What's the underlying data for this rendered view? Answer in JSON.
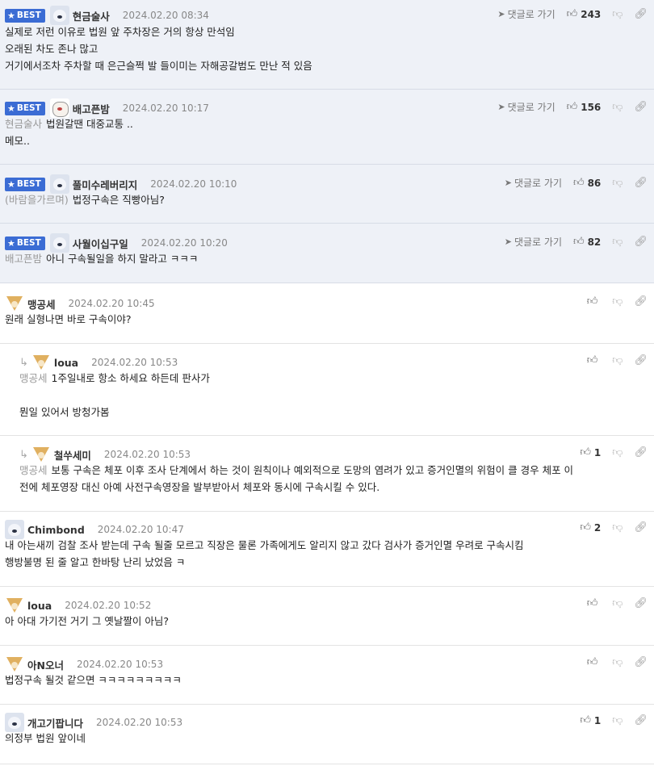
{
  "labels": {
    "best": "BEST",
    "goto": "댓글로 가기"
  },
  "comments": [
    {
      "best": true,
      "avatar": "bear",
      "nick": "현금술사",
      "date": "2024.02.20 08:34",
      "votes": "243",
      "mention": "",
      "lines": [
        "실제로 저런 이유로 법원 앞 주차장은 거의 항상 만석임",
        "오래된 차도 존나 많고",
        "거기에서조차 주차할 때 은근슬쩍 발 들이미는 자해공갈범도 만난 적 있음"
      ]
    },
    {
      "best": true,
      "avatar": "dog",
      "nick": "배고픈밤",
      "date": "2024.02.20 10:17",
      "votes": "156",
      "mention": "현금술사",
      "lines": [
        "법원갈땐 대중교통 ..",
        "메모.."
      ]
    },
    {
      "best": true,
      "avatar": "bear",
      "nick": "풀미수레버리지",
      "date": "2024.02.20 10:10",
      "votes": "86",
      "mention": "(바람을가르며)",
      "lines": [
        "법정구속은 직빵아님?"
      ]
    },
    {
      "best": true,
      "avatar": "bear",
      "nick": "사월이십구일",
      "date": "2024.02.20 10:20",
      "votes": "82",
      "mention": "배고픈밤",
      "lines": [
        "아니 구속될일을 하지 말라고 ㅋㅋㅋ"
      ]
    },
    {
      "best": false,
      "avatar": "fox",
      "nick": "맹공세",
      "date": "2024.02.20 10:45",
      "votes": "",
      "mention": "",
      "lines": [
        "원래 실형나면 바로 구속이야?"
      ]
    },
    {
      "best": false,
      "reply": true,
      "avatar": "fox",
      "nick": "loua",
      "date": "2024.02.20 10:53",
      "votes": "",
      "mention": "맹공세",
      "lines": [
        "1주일내로 항소 하세요 하든데 판사가",
        "",
        "뭔일 있어서 방청가봄"
      ]
    },
    {
      "best": false,
      "reply": true,
      "avatar": "fox",
      "nick": "철쑤세미",
      "date": "2024.02.20 10:53",
      "votes": "1",
      "mention": "맹공세",
      "lines": [
        "보통 구속은 체포 이후 조사 단계에서 하는 것이 원칙이나 예외적으로 도망의 염려가 있고 증거인멸의 위험이 클 경우 체포 이",
        "전에 체포영장 대신 아예 사전구속영장을 발부받아서 체포와 동시에 구속시킬 수 있다."
      ]
    },
    {
      "best": false,
      "avatar": "bear",
      "nick": "Chimbond",
      "date": "2024.02.20 10:47",
      "votes": "2",
      "mention": "",
      "lines": [
        "내 아는새끼 검찰 조사 받는데 구속 될줄 모르고 직장은 물론 가족에게도 알리지 않고 갔다 검사가 증거인멸 우려로 구속시킴",
        "행방불명 된 줄 알고 한바탕 난리 났었음 ㅋ"
      ]
    },
    {
      "best": false,
      "avatar": "fox",
      "nick": "loua",
      "date": "2024.02.20 10:52",
      "votes": "",
      "mention": "",
      "lines": [
        "아 아대 가기전 거기 그 옛날짤이 아님?"
      ]
    },
    {
      "best": false,
      "avatar": "fox",
      "nick": "아N오너",
      "date": "2024.02.20 10:53",
      "votes": "",
      "mention": "",
      "lines": [
        "법정구속 될것 같으면 ㅋㅋㅋㅋㅋㅋㅋㅋㅋ"
      ]
    },
    {
      "best": false,
      "avatar": "bear",
      "nick": "개고기팝니다",
      "date": "2024.02.20 10:53",
      "votes": "1",
      "mention": "",
      "lines": [
        "의정부 법원 앞이네"
      ]
    }
  ]
}
